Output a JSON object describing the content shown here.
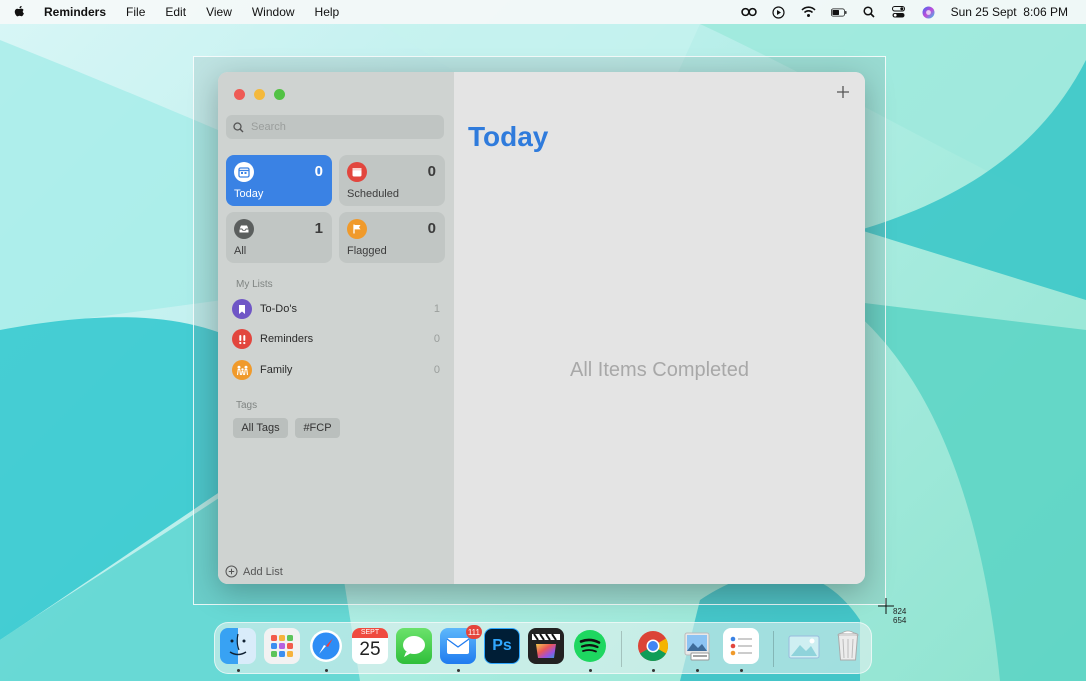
{
  "menubar": {
    "app_name": "Reminders",
    "menus": [
      "File",
      "Edit",
      "View",
      "Window",
      "Help"
    ],
    "clock": "Sun 25 Sept  8:06 PM"
  },
  "window": {
    "search": {
      "placeholder": "Search"
    },
    "smart_lists": [
      {
        "label": "Today",
        "count": "0",
        "icon": "calendar-icon",
        "color": "#3a82e4"
      },
      {
        "label": "Scheduled",
        "count": "0",
        "icon": "calendar-icon",
        "color": "#e2463e"
      },
      {
        "label": "All",
        "count": "1",
        "icon": "tray-icon",
        "color": "#5b5f5e"
      },
      {
        "label": "Flagged",
        "count": "0",
        "icon": "flag-icon",
        "color": "#f09a2b"
      }
    ],
    "my_lists_header": "My Lists",
    "my_lists": [
      {
        "name": "To-Do's",
        "count": "1",
        "icon": "bookmark-icon",
        "color": "#6f56c6"
      },
      {
        "name": "Reminders",
        "count": "0",
        "icon": "exclamation-icon",
        "color": "#e2463e"
      },
      {
        "name": "Family",
        "count": "0",
        "icon": "family-icon",
        "color": "#f09a2b"
      }
    ],
    "tags_header": "Tags",
    "tags": [
      "All Tags",
      "#FCP"
    ],
    "add_list_label": "Add List",
    "main": {
      "title": "Today",
      "empty_message": "All Items Completed"
    }
  },
  "screenshot_overlay": {
    "x_readout": "824",
    "y_readout": "654"
  },
  "dock": {
    "calendar_month": "SEPT",
    "calendar_day": "25",
    "mail_badge": "111",
    "photoshop_label": "Ps",
    "apps": [
      "Finder",
      "Launchpad",
      "Safari",
      "Calendar",
      "Messages",
      "Mail",
      "Photoshop",
      "Final Cut Pro",
      "Spotify",
      "Chrome",
      "Preview",
      "Reminders",
      "Image Folder",
      "Trash"
    ]
  }
}
